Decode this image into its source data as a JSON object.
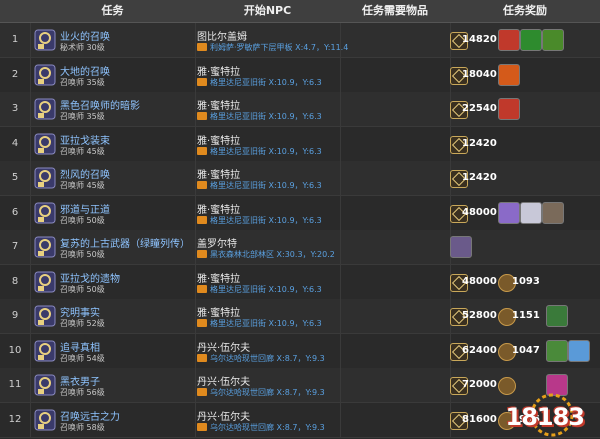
{
  "header": {
    "col_task": "任务",
    "col_npc": "开始NPC",
    "col_items": "任务需要物品",
    "col_reward": "任务奖励"
  },
  "rows": [
    {
      "num": "1",
      "name": "业火的召唤",
      "sub": "秘术师 30级",
      "npc": "图比尔盖姆",
      "loc": "利姆萨·罗敏萨下层甲板 X:4.7，Y:11.4",
      "gil": "14820",
      "items": [
        "#c0392b",
        "#2e8b2e",
        "#4a8a2a"
      ]
    },
    {
      "num": "2",
      "name": "大地的召唤",
      "sub": "召唤师 35级",
      "npc": "雅·蜜特拉",
      "loc": "格里达尼亚旧街 X:10.9，Y:6.3",
      "gil": "18040",
      "items": [
        "#d45a1a"
      ]
    },
    {
      "num": "3",
      "name": "黑色召唤师的暗影",
      "sub": "召唤师 35级",
      "npc": "雅·蜜特拉",
      "loc": "格里达尼亚旧街 X:10.9，Y:6.3",
      "gil": "22540",
      "items": [
        "#c0392b"
      ]
    },
    {
      "num": "4",
      "name": "亚拉戈装束",
      "sub": "召唤师 45级",
      "npc": "雅·蜜特拉",
      "loc": "格里达尼亚旧街 X:10.9，Y:6.3",
      "gil": "12420",
      "items": []
    },
    {
      "num": "5",
      "name": "烈风的召唤",
      "sub": "召唤师 45级",
      "npc": "雅·蜜特拉",
      "loc": "格里达尼亚旧街 X:10.9，Y:6.3",
      "gil": "12420",
      "items": []
    },
    {
      "num": "6",
      "name": "邪道与正道",
      "sub": "召唤师 50级",
      "npc": "雅·蜜特拉",
      "loc": "格里达尼亚旧街 X:10.9，Y:6.3",
      "gil": "48000",
      "items": [
        "#8a6ac8",
        "#c8c8d8",
        "#7a6a5a"
      ]
    },
    {
      "num": "7",
      "name": "复苏的上古武器（绿瞳列传）",
      "sub": "召唤师 50级",
      "npc": "盖罗尔特",
      "loc": "黑衣森林北部林区 X:30.3，Y:20.2",
      "gil": "",
      "items": [
        "#6a5a8a"
      ]
    },
    {
      "num": "8",
      "name": "亚拉戈的遗物",
      "sub": "召唤师 50级",
      "npc": "雅·蜜特拉",
      "loc": "格里达尼亚旧街 X:10.9，Y:6.3",
      "gil": "48000",
      "cb": "1093",
      "items": []
    },
    {
      "num": "9",
      "name": "究明事实",
      "sub": "召唤师 52级",
      "npc": "雅·蜜特拉",
      "loc": "格里达尼亚旧街 X:10.9，Y:6.3",
      "gil": "52800",
      "cb": "1151",
      "items": [
        "#3a7a3a"
      ]
    },
    {
      "num": "10",
      "name": "追寻真相",
      "sub": "召唤师 54级",
      "npc": "丹兴·伍尔夫",
      "loc": "乌尔达哈现世回廊 X:8.7，Y:9.3",
      "gil": "62400",
      "cb": "1047",
      "items": [
        "#4a8a3a",
        "#5a9ad8"
      ]
    },
    {
      "num": "11",
      "name": "黑衣男子",
      "sub": "召唤师 56级",
      "npc": "丹兴·伍尔夫",
      "loc": "乌尔达哈现世回廊 X:8.7，Y:9.3",
      "gil": "72000",
      "cb": "",
      "items": [
        "#b8388a"
      ]
    },
    {
      "num": "12",
      "name": "召唤远古之力",
      "sub": "召唤师 58级",
      "npc": "丹兴·伍尔夫",
      "loc": "乌尔达哈现世回廊 X:8.7，Y:9.3",
      "gil": "81600",
      "cb": "1966",
      "items": []
    }
  ],
  "watermark": {
    "text": "18183"
  },
  "colors": {
    "link": "#8fc4ff",
    "location": "#5aa0e0",
    "flag": "#e08a1e",
    "header_bg": "#3f3f3f"
  }
}
